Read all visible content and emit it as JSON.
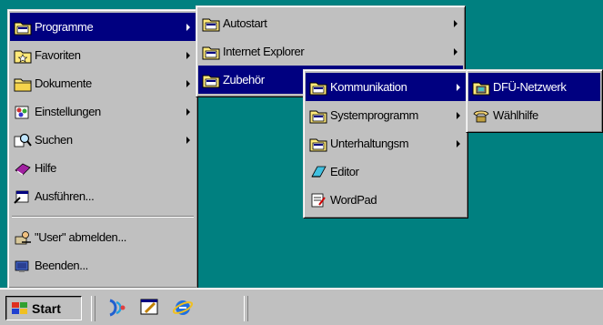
{
  "start_menu": {
    "items": [
      {
        "label": "Programme",
        "icon": "programs-folder-icon",
        "submenu": true,
        "selected": true
      },
      {
        "label": "Favoriten",
        "icon": "favorites-folder-icon",
        "submenu": true
      },
      {
        "label": "Dokumente",
        "icon": "documents-folder-icon",
        "submenu": true
      },
      {
        "label": "Einstellungen",
        "icon": "settings-icon",
        "submenu": true
      },
      {
        "label": "Suchen",
        "icon": "search-icon",
        "submenu": true
      },
      {
        "label": "Hilfe",
        "icon": "help-book-icon",
        "submenu": false
      },
      {
        "label": "Ausführen...",
        "icon": "run-icon",
        "submenu": false
      },
      {
        "label": "\"User\" abmelden...",
        "icon": "logoff-icon",
        "submenu": false
      },
      {
        "label": "Beenden...",
        "icon": "shutdown-icon",
        "submenu": false
      }
    ]
  },
  "programs_menu": {
    "items": [
      {
        "label": "Autostart",
        "icon": "program-group-icon",
        "submenu": true
      },
      {
        "label": "Internet Explorer",
        "icon": "program-group-icon",
        "submenu": true
      },
      {
        "label": "Zubehör",
        "icon": "program-group-icon",
        "submenu": true,
        "selected": true
      }
    ]
  },
  "accessories_menu": {
    "items": [
      {
        "label": "Kommunikation",
        "icon": "program-group-icon",
        "submenu": true,
        "selected": true
      },
      {
        "label": "Systemprogramm",
        "icon": "program-group-icon",
        "submenu": true
      },
      {
        "label": "Unterhaltungsm",
        "icon": "program-group-icon",
        "submenu": true
      },
      {
        "label": "Editor",
        "icon": "notepad-icon",
        "submenu": false
      },
      {
        "label": "WordPad",
        "icon": "wordpad-icon",
        "submenu": false
      }
    ]
  },
  "communication_menu": {
    "items": [
      {
        "label": "DFÜ-Netzwerk",
        "icon": "dialup-network-icon",
        "selected": true
      },
      {
        "label": "Wählhilfe",
        "icon": "phone-dialer-icon"
      }
    ]
  },
  "taskbar": {
    "start_label": "Start",
    "quick_launch": [
      "channels-icon",
      "desktop-icon",
      "internet-explorer-icon"
    ]
  },
  "colors": {
    "desktop": "#008080",
    "menu": "#c0c0c0",
    "highlight": "#000080"
  }
}
